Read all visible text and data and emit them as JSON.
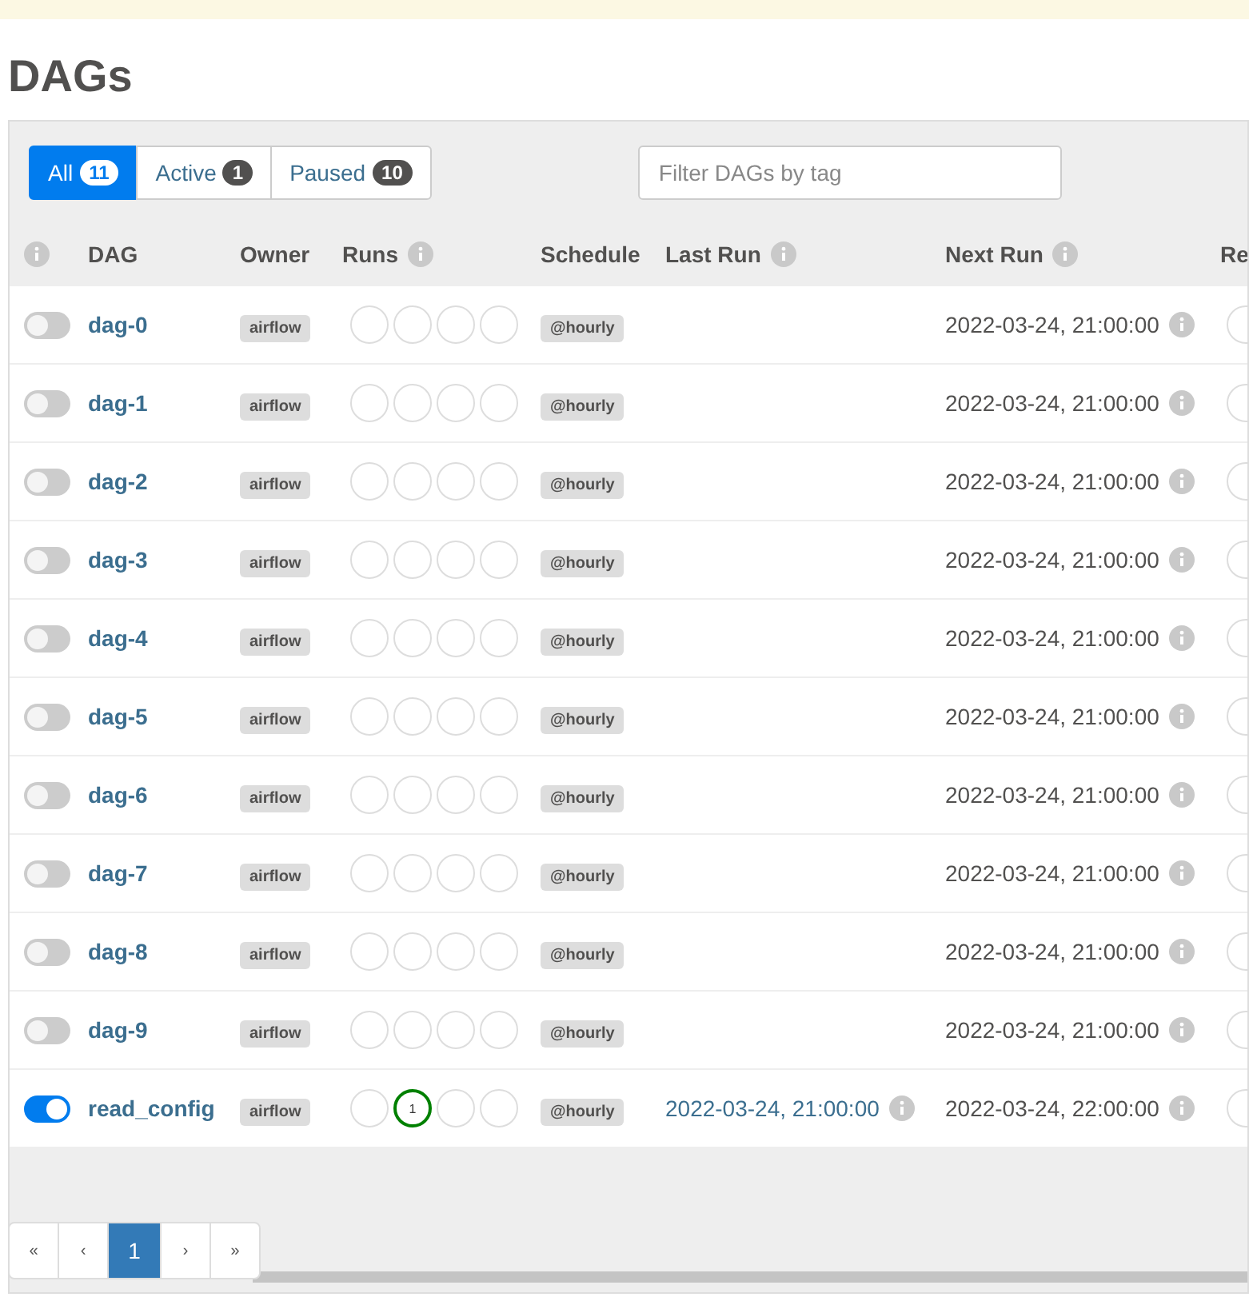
{
  "title": "DAGs",
  "filters": [
    {
      "label": "All",
      "count": "11",
      "selected": true
    },
    {
      "label": "Active",
      "count": "1",
      "selected": false
    },
    {
      "label": "Paused",
      "count": "10",
      "selected": false
    }
  ],
  "tag_filter": {
    "placeholder": "Filter DAGs by tag"
  },
  "table": {
    "columns": [
      {
        "label": "DAG",
        "info": false
      },
      {
        "label": "Owner",
        "info": false
      },
      {
        "label": "Runs",
        "info": true
      },
      {
        "label": "Schedule",
        "info": false
      },
      {
        "label": "Last Run",
        "info": true
      },
      {
        "label": "Next Run",
        "info": true
      },
      {
        "label": "Re"
      }
    ],
    "rows": [
      {
        "active": false,
        "dag": "dag-0",
        "owner": "airflow",
        "runs": [
          {
            "kind": "empty"
          },
          {
            "kind": "empty"
          },
          {
            "kind": "empty"
          },
          {
            "kind": "empty"
          }
        ],
        "schedule": "@hourly",
        "next_run": "2022-03-24, 21:00:00"
      },
      {
        "active": false,
        "dag": "dag-1",
        "owner": "airflow",
        "runs": [
          {
            "kind": "empty"
          },
          {
            "kind": "empty"
          },
          {
            "kind": "empty"
          },
          {
            "kind": "empty"
          }
        ],
        "schedule": "@hourly",
        "next_run": "2022-03-24, 21:00:00"
      },
      {
        "active": false,
        "dag": "dag-2",
        "owner": "airflow",
        "runs": [
          {
            "kind": "empty"
          },
          {
            "kind": "empty"
          },
          {
            "kind": "empty"
          },
          {
            "kind": "empty"
          }
        ],
        "schedule": "@hourly",
        "next_run": "2022-03-24, 21:00:00"
      },
      {
        "active": false,
        "dag": "dag-3",
        "owner": "airflow",
        "runs": [
          {
            "kind": "empty"
          },
          {
            "kind": "empty"
          },
          {
            "kind": "empty"
          },
          {
            "kind": "empty"
          }
        ],
        "schedule": "@hourly",
        "next_run": "2022-03-24, 21:00:00"
      },
      {
        "active": false,
        "dag": "dag-4",
        "owner": "airflow",
        "runs": [
          {
            "kind": "empty"
          },
          {
            "kind": "empty"
          },
          {
            "kind": "empty"
          },
          {
            "kind": "empty"
          }
        ],
        "schedule": "@hourly",
        "next_run": "2022-03-24, 21:00:00"
      },
      {
        "active": false,
        "dag": "dag-5",
        "owner": "airflow",
        "runs": [
          {
            "kind": "empty"
          },
          {
            "kind": "empty"
          },
          {
            "kind": "empty"
          },
          {
            "kind": "empty"
          }
        ],
        "schedule": "@hourly",
        "next_run": "2022-03-24, 21:00:00"
      },
      {
        "active": false,
        "dag": "dag-6",
        "owner": "airflow",
        "runs": [
          {
            "kind": "empty"
          },
          {
            "kind": "empty"
          },
          {
            "kind": "empty"
          },
          {
            "kind": "empty"
          }
        ],
        "schedule": "@hourly",
        "next_run": "2022-03-24, 21:00:00"
      },
      {
        "active": false,
        "dag": "dag-7",
        "owner": "airflow",
        "runs": [
          {
            "kind": "empty"
          },
          {
            "kind": "empty"
          },
          {
            "kind": "empty"
          },
          {
            "kind": "empty"
          }
        ],
        "schedule": "@hourly",
        "next_run": "2022-03-24, 21:00:00"
      },
      {
        "active": false,
        "dag": "dag-8",
        "owner": "airflow",
        "runs": [
          {
            "kind": "empty"
          },
          {
            "kind": "empty"
          },
          {
            "kind": "empty"
          },
          {
            "kind": "empty"
          }
        ],
        "schedule": "@hourly",
        "next_run": "2022-03-24, 21:00:00"
      },
      {
        "active": false,
        "dag": "dag-9",
        "owner": "airflow",
        "runs": [
          {
            "kind": "empty"
          },
          {
            "kind": "empty"
          },
          {
            "kind": "empty"
          },
          {
            "kind": "empty"
          }
        ],
        "schedule": "@hourly",
        "next_run": "2022-03-24, 21:00:00"
      },
      {
        "active": true,
        "dag": "read_config",
        "owner": "airflow",
        "runs": [
          {
            "kind": "empty"
          },
          {
            "kind": "success",
            "count": "1"
          },
          {
            "kind": "empty"
          },
          {
            "kind": "empty"
          }
        ],
        "schedule": "@hourly",
        "last_run": "2022-03-24, 21:00:00",
        "next_run": "2022-03-24, 22:00:00"
      }
    ]
  },
  "pagination": [
    {
      "label": "«",
      "selected": false
    },
    {
      "label": "‹",
      "selected": false
    },
    {
      "label": "1",
      "selected": true
    },
    {
      "label": "›",
      "selected": false
    },
    {
      "label": "»",
      "selected": false
    }
  ]
}
